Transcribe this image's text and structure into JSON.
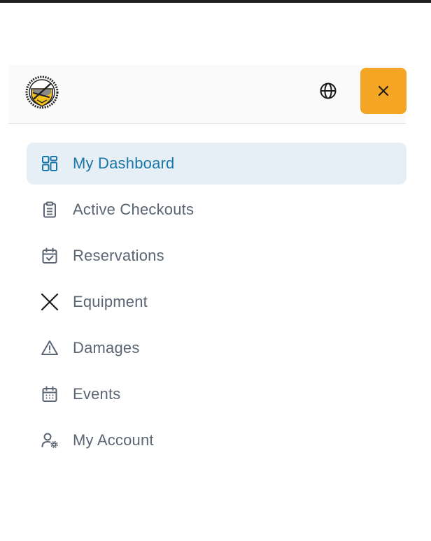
{
  "header": {
    "logo_icon": "shield-emblem-icon",
    "language_icon": "globe-icon",
    "close_icon": "close-icon",
    "close_label": "×",
    "accent_color": "#f5a524"
  },
  "nav": {
    "active_index": 0,
    "active_color": "#1976a8",
    "items": [
      {
        "label": "My Dashboard",
        "icon": "dashboard-grid-icon"
      },
      {
        "label": "Active Checkouts",
        "icon": "clipboard-list-icon"
      },
      {
        "label": "Reservations",
        "icon": "calendar-check-icon"
      },
      {
        "label": "Equipment",
        "icon": "crossed-paddles-icon"
      },
      {
        "label": "Damages",
        "icon": "warning-triangle-icon"
      },
      {
        "label": "Events",
        "icon": "calendar-grid-icon"
      },
      {
        "label": "My Account",
        "icon": "user-gear-icon"
      }
    ]
  }
}
